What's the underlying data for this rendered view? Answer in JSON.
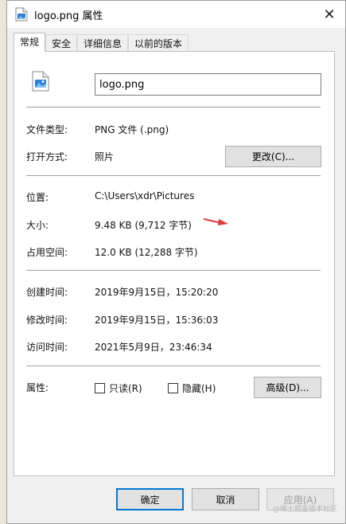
{
  "window": {
    "title": "logo.png 属性",
    "close_glyph": "✕"
  },
  "tabs": [
    "常规",
    "安全",
    "详细信息",
    "以前的版本"
  ],
  "general": {
    "file_name": "logo.png",
    "type_label": "文件类型:",
    "type_value": "PNG 文件 (.png)",
    "open_with_label": "打开方式:",
    "open_with_value": "照片",
    "change_button": "更改(C)...",
    "location_label": "位置:",
    "location_value": "C:\\Users\\xdr\\Pictures",
    "size_label": "大小:",
    "size_value": "9.48 KB (9,712 字节)",
    "size_on_disk_label": "占用空间:",
    "size_on_disk_value": "12.0 KB (12,288 字节)",
    "created_label": "创建时间:",
    "created_value": "2019年9月15日，15:20:20",
    "modified_label": "修改时间:",
    "modified_value": "2019年9月15日，15:36:03",
    "accessed_label": "访问时间:",
    "accessed_value": "2021年5月9日，23:46:34",
    "attributes_label": "属性:",
    "readonly_label": "只读(R)",
    "hidden_label": "隐藏(H)",
    "advanced_button": "高级(D)..."
  },
  "footer": {
    "ok": "确定",
    "cancel": "取消",
    "apply": "应用(A)"
  },
  "watermark": "@稀土掘金技术社区",
  "colors": {
    "accent": "#0078d7",
    "arrow": "#e0393e"
  }
}
